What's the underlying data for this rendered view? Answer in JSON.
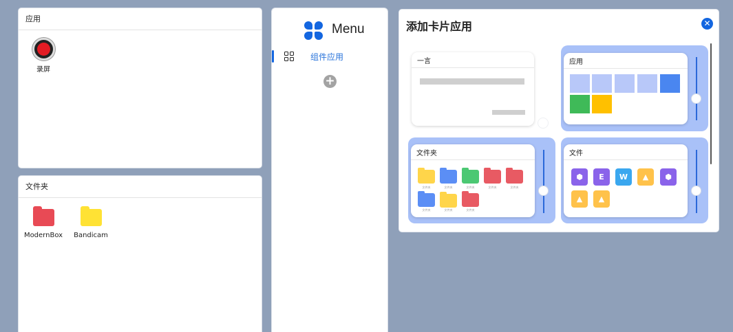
{
  "apps_panel": {
    "title": "应用",
    "items": [
      {
        "label": "录屏",
        "icon": "record-icon"
      }
    ]
  },
  "folder_panel": {
    "title": "文件夹",
    "items": [
      {
        "label": "ModernBox",
        "icon": "folder-icon",
        "color": "#e84a55"
      },
      {
        "label": "Bandicam",
        "icon": "folder-icon",
        "color": "#ffe234"
      }
    ]
  },
  "menu": {
    "title": "Menu",
    "items": [
      {
        "label": "组件应用",
        "icon": "grid-icon",
        "active": true
      }
    ],
    "add_icon": "plus-icon",
    "accent": "#1366e0"
  },
  "dialog": {
    "title": "添加卡片应用",
    "close_icon": "close-icon",
    "cards": [
      {
        "title": "一言",
        "selected": false
      },
      {
        "title": "应用",
        "selected": true,
        "tiles": [
          "#b8c8f9",
          "#b8c8f9",
          "#b8c8f9",
          "#b8c8f9",
          "#4a86f0",
          "#3fba58",
          "#ffc000"
        ]
      },
      {
        "title": "文件夹",
        "selected": true,
        "folders": [
          {
            "color": "#ffd54a",
            "caption": "文件夹"
          },
          {
            "color": "#5b8ef5",
            "caption": "文件夹"
          },
          {
            "color": "#4cc873",
            "caption": "文件夹"
          },
          {
            "color": "#e85a63",
            "caption": "文件夹"
          },
          {
            "color": "#e85a63",
            "caption": "文件夹"
          },
          {
            "color": "#5b8ef5",
            "caption": "文件夹"
          },
          {
            "color": "#ffd54a",
            "caption": "文件夹"
          },
          {
            "color": "#e85a63",
            "caption": "文件夹"
          }
        ]
      },
      {
        "title": "文件",
        "selected": true,
        "files": [
          {
            "icon": "cube-icon",
            "color": "#8a63ea"
          },
          {
            "icon": "letter-e-icon",
            "color": "#8a63ea",
            "glyph": "E"
          },
          {
            "icon": "wps-icon",
            "color": "#3aa7ef"
          },
          {
            "icon": "image-icon",
            "color": "#ffc24a"
          },
          {
            "icon": "cube-icon",
            "color": "#8a63ea"
          },
          {
            "icon": "image-icon",
            "color": "#ffc24a"
          },
          {
            "icon": "image-icon",
            "color": "#ffc24a"
          }
        ]
      }
    ],
    "selected_slot_color": "#a9c1f8"
  }
}
